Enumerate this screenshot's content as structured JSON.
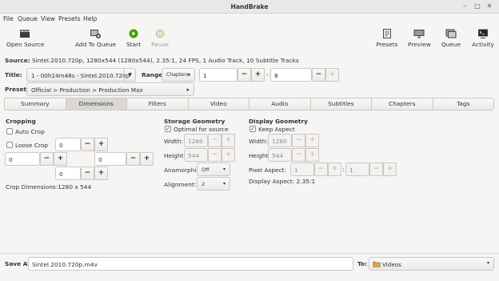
{
  "window": {
    "title": "HandBrake"
  },
  "menu": [
    "File",
    "Queue",
    "View",
    "Presets",
    "Help"
  ],
  "toolbar": {
    "open_source": "Open Source",
    "add_to_queue": "Add To Queue",
    "start": "Start",
    "pause": "Pause",
    "presets": "Presets",
    "preview": "Preview",
    "queue": "Queue",
    "activity": "Activity"
  },
  "source": {
    "label": "Source:",
    "value": "Sintel.2010.720p, 1280x544 (1280x544), 2.35:1, 24 FPS, 1 Audio Track, 10 Subtitle Tracks"
  },
  "title_row": {
    "title_label": "Title:",
    "title_value": "1 - 00h14m48s - Sintel.2010.720p",
    "range_label": "Range:",
    "range_type": "Chapters:",
    "range_start": "1",
    "range_dash": "-",
    "range_end": "8"
  },
  "preset": {
    "label": "Preset:",
    "value": "Official > Production > Production Max"
  },
  "tabs": [
    "Summary",
    "Dimensions",
    "Filters",
    "Video",
    "Audio",
    "Subtitles",
    "Chapters",
    "Tags"
  ],
  "cropping": {
    "heading": "Cropping",
    "auto_crop": "Auto Crop",
    "loose_crop": "Loose Crop",
    "top": "0",
    "left": "0",
    "right": "0",
    "bottom": "0",
    "dimensions": "Crop Dimensions:1280 x 544"
  },
  "storage": {
    "heading": "Storage Geometry",
    "optimal": "Optimal for source",
    "width_label": "Width:",
    "width": "1280",
    "height_label": "Height:",
    "height": "544",
    "anamorphic_label": "Anamorphic:",
    "anamorphic": "Off",
    "alignment_label": "Alignment:",
    "alignment": "2"
  },
  "display": {
    "heading": "Display Geometry",
    "keep_aspect": "Keep Aspect",
    "width_label": "Width:",
    "width": "1280",
    "height_label": "Height:",
    "height": "544",
    "pixel_aspect_label": "Pixel Aspect:",
    "pixel_w": "1",
    "colon": ":",
    "pixel_h": "1",
    "display_aspect": "Display Aspect: 2.35:1"
  },
  "save": {
    "label": "Save As:",
    "value": "Sintel.2010.720p.m4v",
    "to_label": "To:",
    "folder": "Videos"
  },
  "controls": {
    "minus": "−",
    "plus": "+",
    "check": "✓"
  }
}
